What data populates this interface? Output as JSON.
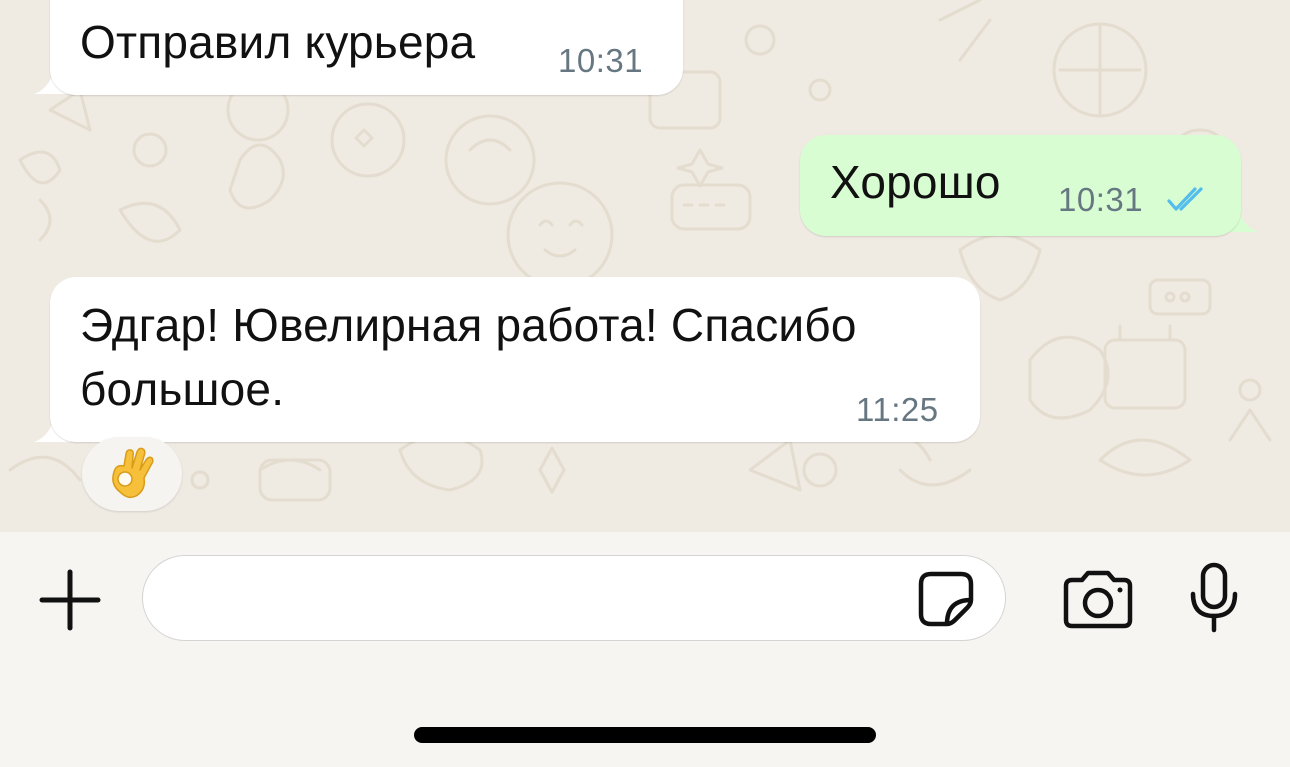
{
  "messages": [
    {
      "direction": "incoming",
      "text": "Отправил курьера",
      "time": "10:31"
    },
    {
      "direction": "outgoing",
      "text": "Хорошо",
      "time": "10:31",
      "status": "read",
      "status_icon": "double-check-icon",
      "status_color": "#53bdeb"
    },
    {
      "direction": "incoming",
      "text_line1": "Эдгар! Ювелирная работа! Спасибо",
      "text_line2": "большое.",
      "time": "11:25",
      "reaction": "👌"
    }
  ],
  "composer": {
    "placeholder": "",
    "value": "",
    "icons": [
      "plus-icon",
      "sticker-icon",
      "camera-icon",
      "microphone-icon"
    ]
  },
  "colors": {
    "chat_background": "#efeae2",
    "incoming_bubble": "#ffffff",
    "outgoing_bubble": "#d9fdd3",
    "timestamp": "#667781"
  }
}
